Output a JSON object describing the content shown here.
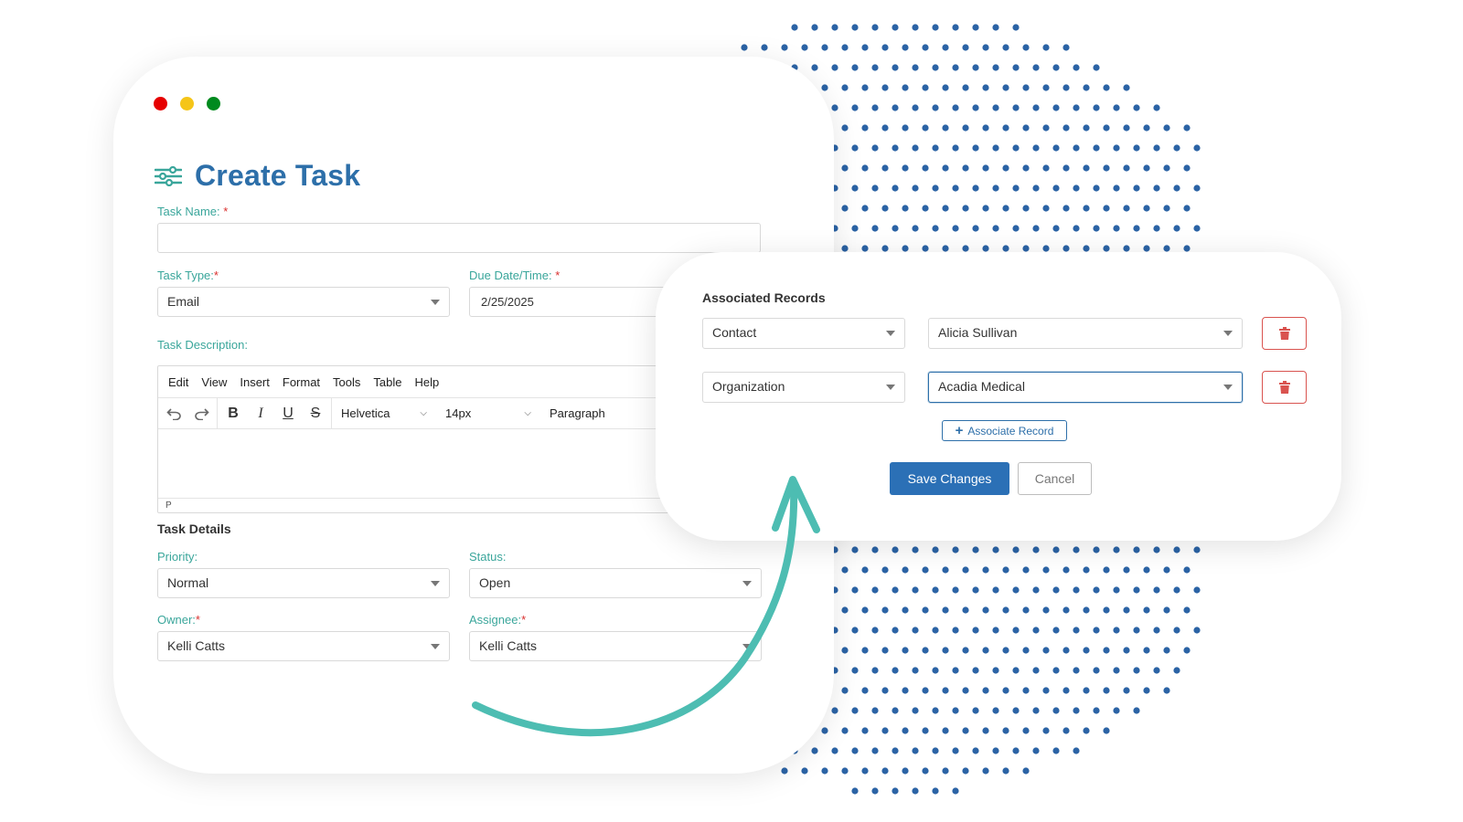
{
  "colors": {
    "title_blue": "#2d6fa9",
    "label_teal": "#3aa69b",
    "dots_blue": "#2b63a5",
    "arrow_teal": "#4dbdb2",
    "save_blue": "#2b70b6",
    "delete_red": "#d9534f"
  },
  "icons": {
    "title": "sliders-icon",
    "undo": "undo-icon",
    "redo": "redo-icon",
    "delete": "trash-icon",
    "add": "plus-icon"
  },
  "form": {
    "title": "Create Task",
    "task_name": {
      "label": "Task Name:",
      "required": "*",
      "value": ""
    },
    "task_type": {
      "label": "Task Type:",
      "required": "*",
      "value": "Email"
    },
    "due_date": {
      "label": "Due Date/Time:",
      "required": "*",
      "value": "2/25/2025"
    },
    "description": {
      "label": "Task Description:",
      "menu": [
        "Edit",
        "View",
        "Insert",
        "Format",
        "Tools",
        "Table",
        "Help"
      ],
      "bold": "B",
      "italic": "I",
      "underline": "U",
      "strike": "S",
      "font": "Helvetica",
      "size": "14px",
      "block": "Paragraph",
      "status": "P"
    },
    "details_title": "Task Details",
    "priority": {
      "label": "Priority:",
      "value": "Normal"
    },
    "status": {
      "label": "Status:",
      "value": "Open"
    },
    "owner": {
      "label": "Owner:",
      "required": "*",
      "value": "Kelli Catts"
    },
    "assignee": {
      "label": "Assignee:",
      "required": "*",
      "value": "Kelli Catts"
    }
  },
  "associated": {
    "title": "Associated Records",
    "rows": [
      {
        "type": "Contact",
        "record": "Alicia Sullivan"
      },
      {
        "type": "Organization",
        "record": "Acadia Medical"
      }
    ],
    "associate_button": "Associate Record",
    "save_button": "Save Changes",
    "cancel_button": "Cancel"
  }
}
